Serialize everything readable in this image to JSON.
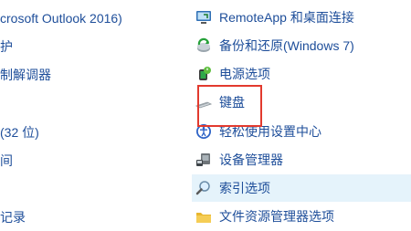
{
  "left_items": [
    {
      "label": "crosoft Outlook 2016)"
    },
    {
      "label": "护"
    },
    {
      "label": "制解调器"
    },
    {
      "label": ""
    },
    {
      "label": "(32 位)"
    },
    {
      "label": "间"
    },
    {
      "label": ""
    },
    {
      "label": "记录"
    }
  ],
  "right_items": [
    {
      "label": "RemoteApp 和桌面连接",
      "icon": "remoteapp-icon"
    },
    {
      "label": "备份和还原(Windows 7)",
      "icon": "backup-restore-icon"
    },
    {
      "label": "电源选项",
      "icon": "power-options-icon"
    },
    {
      "label": "键盘",
      "icon": "keyboard-icon"
    },
    {
      "label": "轻松使用设置中心",
      "icon": "ease-of-access-icon"
    },
    {
      "label": "设备管理器",
      "icon": "device-manager-icon"
    },
    {
      "label": "索引选项",
      "icon": "indexing-options-icon"
    },
    {
      "label": "文件资源管理器选项",
      "icon": "file-explorer-options-icon"
    }
  ],
  "colors": {
    "link": "#1e4e9a",
    "hover_bg": "#e5f3fb",
    "highlight_border": "#e23a2e"
  }
}
